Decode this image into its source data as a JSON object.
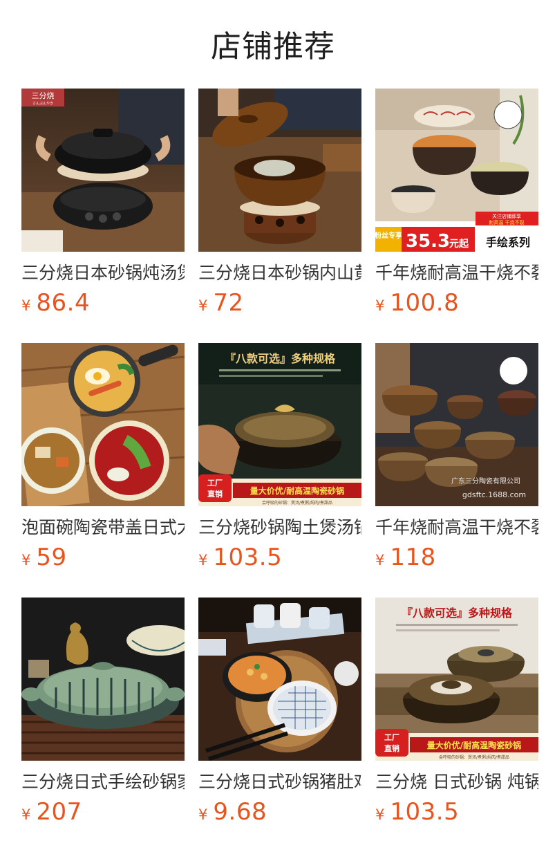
{
  "page": {
    "title": "店铺推荐"
  },
  "currency_symbol": "¥",
  "products": [
    {
      "title": "三分烧日本砂锅炖汤煲",
      "price": "86.4",
      "badge": "三分烧",
      "badge_sub": "さんぶんやき",
      "image": "black-clay-pot-on-stove"
    },
    {
      "title": "三分烧日本砂锅内山黄",
      "price": "72",
      "image": "brown-clay-pot-with-lid"
    },
    {
      "title": "千年烧耐高温干烧不裂",
      "price": "100.8",
      "image": "hand-painted-clay-pots",
      "banner": {
        "top1": "关注店铺即享",
        "top2": "耐高温 干烧不裂",
        "tag": "粉丝专享",
        "big": "35.3",
        "unit": "元起",
        "series": "手绘系列"
      }
    },
    {
      "title": "泡面碗陶瓷带盖日式大",
      "price": "59",
      "image": "noodle-bowls"
    },
    {
      "title": "三分烧砂锅陶土煲汤锅",
      "price": "103.5",
      "image": "ornate-clay-pot",
      "banner": {
        "headline": "『八款可选』多种规格",
        "factory": "工厂直销",
        "strip": "量大价优/耐高温陶瓷砂锅",
        "sub": "会呼吸的砂锅：煲汤/煮粥/焖肉/煮甜品"
      }
    },
    {
      "title": "千年烧耐高温干烧不裂",
      "price": "118",
      "image": "clay-pot-collection",
      "watermark1": "广东三分陶瓷有限公司",
      "watermark2": "gdsftc.1688.com"
    },
    {
      "title": "三分烧日式手绘砂锅家",
      "price": "207",
      "image": "green-striped-pot"
    },
    {
      "title": "三分烧日式砂锅猪肚鸡",
      "price": "9.68",
      "image": "blue-checked-pot-table"
    },
    {
      "title": "三分烧 日式砂锅 炖锅",
      "price": "103.5",
      "image": "ornate-pots-on-wood",
      "banner": {
        "headline": "『八款可选』多种规格",
        "factory": "工厂直销",
        "strip": "量大价优/耐高温陶瓷砂锅",
        "sub": "会呼吸的砂锅：煲汤/煮粥/焖肉/煮甜品"
      }
    }
  ]
}
